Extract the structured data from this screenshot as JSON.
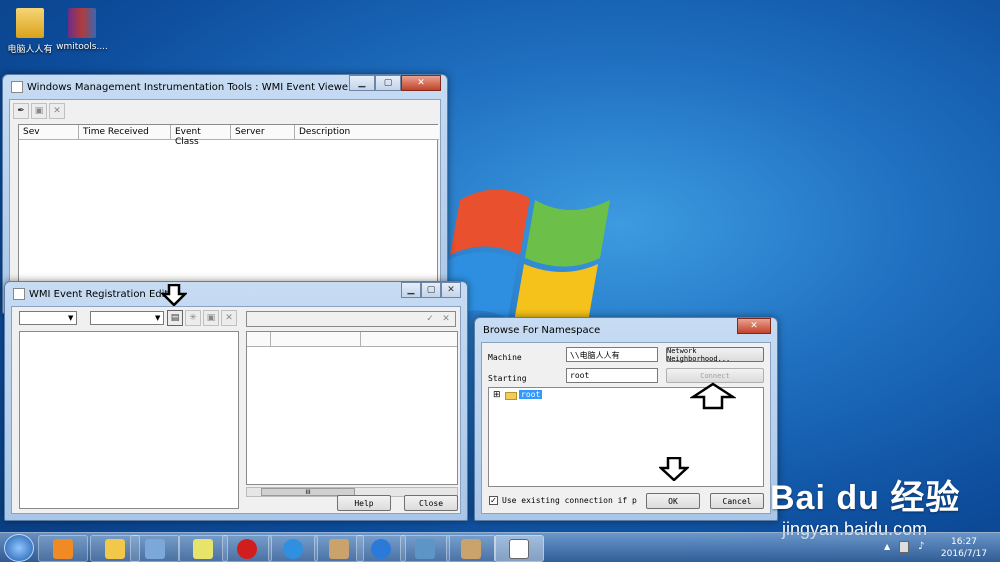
{
  "desktop": {
    "icons": [
      {
        "label": "电脑人人有"
      },
      {
        "label": "wmitools...."
      }
    ]
  },
  "event_viewer": {
    "title": "Windows Management Instrumentation Tools : WMI Event Viewer",
    "columns": [
      "Sev",
      "Time Received",
      "Event Class",
      "Server",
      "Description"
    ]
  },
  "reg_editor": {
    "title": "WMI Event Registration Editor",
    "help": "Help",
    "close": "Close",
    "scroll_grip": "III"
  },
  "browse": {
    "title": "Browse For Namespace",
    "machine_label": "Machine",
    "machine_value": "\\\\电脑人人有",
    "network_button": "Network Neighborhood...",
    "starting_label": "Starting",
    "starting_value": "root",
    "connect_button": "Connect",
    "tree_root": "root",
    "tree_expand": "⊞",
    "checkbox_label": "Use existing connection if p",
    "ok": "OK",
    "cancel": "Cancel"
  },
  "watermark": {
    "brand": "Bai du 经验",
    "url": "jingyan.baidu.com"
  },
  "taskbar": {
    "time": "16:27",
    "date": "2016/7/17"
  },
  "colors": {
    "selection": "#3399ff",
    "close_red": "#c2432a"
  }
}
